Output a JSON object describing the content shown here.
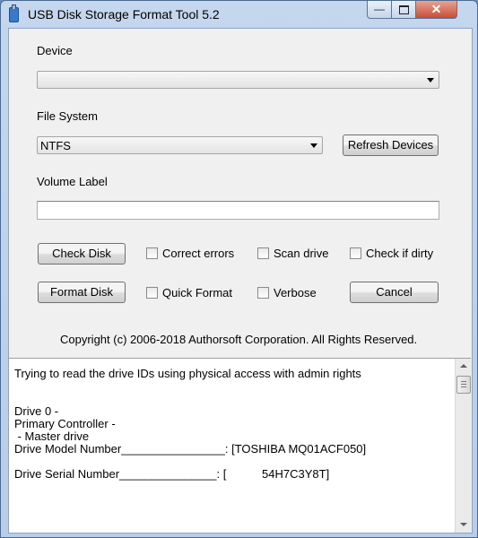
{
  "window": {
    "title": "USB Disk Storage Format Tool 5.2",
    "min_glyph": "—",
    "close_glyph": "✕"
  },
  "device": {
    "label": "Device",
    "value": ""
  },
  "file_system": {
    "label": "File System",
    "value": "NTFS"
  },
  "buttons": {
    "refresh": "Refresh Devices",
    "check_disk": "Check Disk",
    "format_disk": "Format Disk",
    "cancel": "Cancel"
  },
  "volume_label": {
    "label": "Volume Label",
    "value": ""
  },
  "options": {
    "correct_errors": "Correct errors",
    "scan_drive": "Scan drive",
    "check_if_dirty": "Check if dirty",
    "quick_format": "Quick Format",
    "verbose": "Verbose"
  },
  "copyright": "Copyright (c) 2006-2018 Authorsoft Corporation. All Rights Reserved.",
  "log": {
    "lines": [
      "Trying to read the drive IDs using physical access with admin rights",
      "",
      "",
      "Drive 0 -",
      "Primary Controller -",
      " - Master drive",
      "Drive Model Number________________: [TOSHIBA MQ01ACF050]",
      "",
      "Drive Serial Number_______________: [           54H7C3Y8T]"
    ]
  }
}
